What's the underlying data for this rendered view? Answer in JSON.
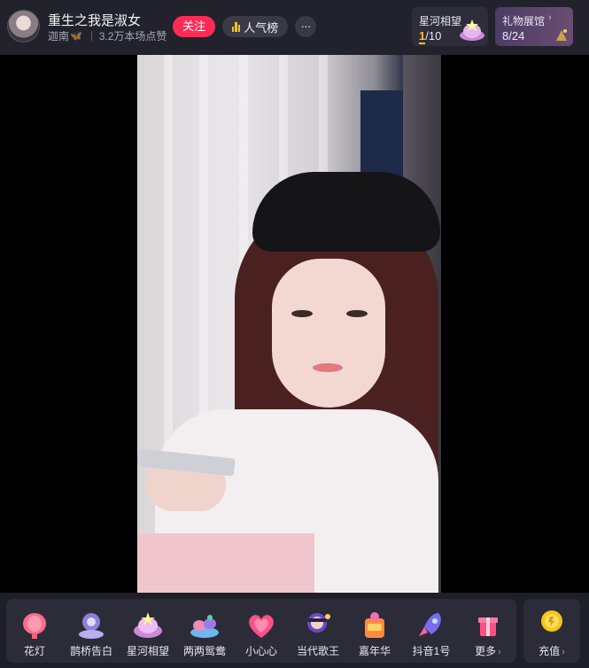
{
  "header": {
    "anchor_name": "重生之我是淑女",
    "anchor_tag": "迦南",
    "likes": "3.2万本场点赞",
    "follow_label": "关注",
    "rank_label": "人气榜",
    "more_label": "···"
  },
  "star_task": {
    "title": "星河相望",
    "current": "1",
    "total": "/10"
  },
  "gift_hall": {
    "title": "礼物展馆",
    "count": "8/24"
  },
  "gifts": [
    {
      "label": "花灯",
      "icon": "lantern-icon"
    },
    {
      "label": "鹊桥告白",
      "icon": "magpie-bridge-icon"
    },
    {
      "label": "星河相望",
      "icon": "star-river-icon"
    },
    {
      "label": "两两鸳鸯",
      "icon": "mandarin-ducks-icon"
    },
    {
      "label": "小心心",
      "icon": "heart-icon"
    },
    {
      "label": "当代歌王",
      "icon": "singer-icon"
    },
    {
      "label": "嘉年华",
      "icon": "carnival-icon"
    },
    {
      "label": "抖音1号",
      "icon": "rocket-icon"
    },
    {
      "label": "更多",
      "icon": "gift-box-icon"
    }
  ],
  "recharge": {
    "label": "充值",
    "icon": "coin-icon"
  },
  "colors": {
    "follow": "#fe2c55",
    "accent_gold": "#f5c518",
    "bg": "#1f1f29"
  }
}
